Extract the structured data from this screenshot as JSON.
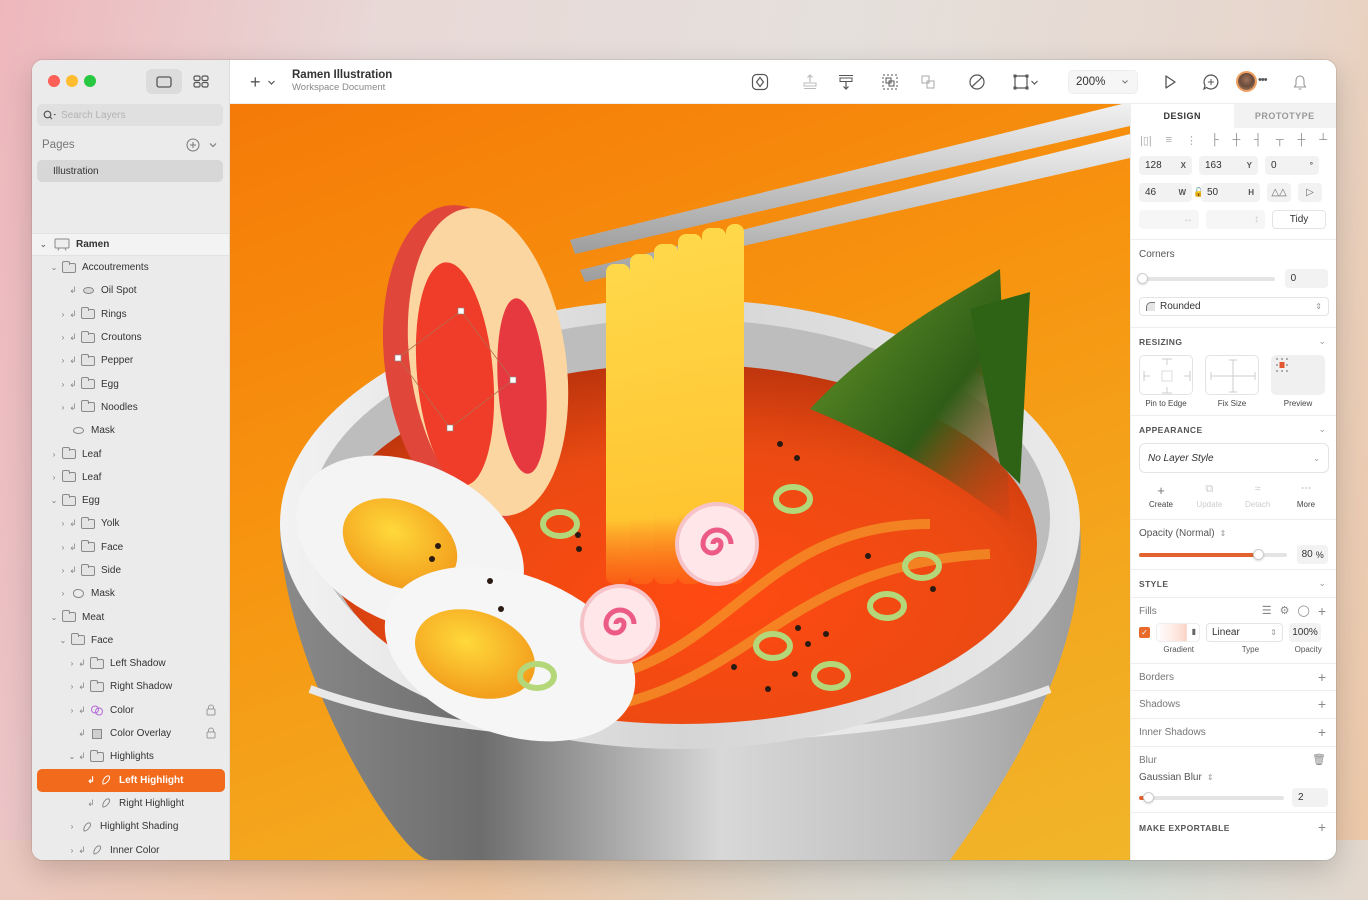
{
  "window": {
    "traffic_lights": [
      "close",
      "minimize",
      "zoom"
    ]
  },
  "sidebar": {
    "search_placeholder": "Search Layers",
    "pages_label": "Pages",
    "pages": [
      {
        "label": "Illustration",
        "selected": true
      }
    ],
    "layers": [
      {
        "label": "Ramen",
        "type": "artboard",
        "depth": 0,
        "expanded": true
      },
      {
        "label": "Accoutrements",
        "type": "group",
        "depth": 1,
        "expanded": true
      },
      {
        "label": "Oil Spot",
        "type": "oval",
        "depth": 2,
        "masked": true
      },
      {
        "label": "Rings",
        "type": "group",
        "depth": 2,
        "masked": true,
        "collapsed": true
      },
      {
        "label": "Croutons",
        "type": "group",
        "depth": 2,
        "masked": true,
        "collapsed": true
      },
      {
        "label": "Pepper",
        "type": "group",
        "depth": 2,
        "masked": true,
        "collapsed": true
      },
      {
        "label": "Egg",
        "type": "group",
        "depth": 2,
        "masked": true,
        "collapsed": true
      },
      {
        "label": "Noodles",
        "type": "group",
        "depth": 2,
        "masked": true,
        "collapsed": true
      },
      {
        "label": "Mask",
        "type": "oval-outline",
        "depth": 2
      },
      {
        "label": "Leaf",
        "type": "group",
        "depth": 1,
        "collapsed": true
      },
      {
        "label": "Leaf",
        "type": "group",
        "depth": 1,
        "collapsed": true
      },
      {
        "label": "Egg",
        "type": "group",
        "depth": 1,
        "expanded": true
      },
      {
        "label": "Yolk",
        "type": "group",
        "depth": 2,
        "masked": true,
        "collapsed": true
      },
      {
        "label": "Face",
        "type": "group",
        "depth": 2,
        "masked": true,
        "collapsed": true
      },
      {
        "label": "Side",
        "type": "group",
        "depth": 2,
        "masked": true,
        "collapsed": true
      },
      {
        "label": "Mask",
        "type": "shape-outline",
        "depth": 2,
        "collapsed": true
      },
      {
        "label": "Meat",
        "type": "group",
        "depth": 1,
        "expanded": true
      },
      {
        "label": "Face",
        "type": "group",
        "depth": 2,
        "expanded": true
      },
      {
        "label": "Left Shadow",
        "type": "group",
        "depth": 3,
        "masked": true,
        "collapsed": true
      },
      {
        "label": "Right Shadow",
        "type": "group",
        "depth": 3,
        "masked": true,
        "collapsed": true
      },
      {
        "label": "Color",
        "type": "symbol",
        "depth": 3,
        "masked": true,
        "collapsed": true,
        "locked": true
      },
      {
        "label": "Color Overlay",
        "type": "rect",
        "depth": 3,
        "masked": true,
        "locked": true
      },
      {
        "label": "Highlights",
        "type": "group",
        "depth": 3,
        "masked": true,
        "expanded": true
      },
      {
        "label": "Left Highlight",
        "type": "path",
        "depth": 4,
        "masked": true,
        "selected": true
      },
      {
        "label": "Right Highlight",
        "type": "path",
        "depth": 4,
        "masked": true
      },
      {
        "label": "Highlight Shading",
        "type": "path",
        "depth": 3,
        "collapsed": true
      },
      {
        "label": "Inner Color",
        "type": "path",
        "depth": 3,
        "masked": true,
        "collapsed": true
      }
    ]
  },
  "toolbar": {
    "doc_title": "Ramen Illustration",
    "doc_subtitle": "Workspace Document",
    "zoom_level": "200%",
    "icons": [
      "insert-plus",
      "create-symbol",
      "forward",
      "backward",
      "mask",
      "ungroup",
      "edit-path",
      "transform",
      "zoom-dropdown",
      "play-prototype",
      "comments",
      "avatar",
      "notifications"
    ]
  },
  "inspector": {
    "tabs": [
      "DESIGN",
      "PROTOTYPE"
    ],
    "active_tab": "DESIGN",
    "x": "128",
    "x_unit": "X",
    "y": "163",
    "y_unit": "Y",
    "rotation": "0",
    "rotation_unit": "°",
    "w": "46",
    "w_unit": "W",
    "h": "50",
    "h_unit": "H",
    "tidy_label": "Tidy",
    "corners_label": "Corners",
    "corners_value": "0",
    "corner_style": "Rounded",
    "resizing_title": "RESIZING",
    "resizing_options": [
      "Pin to Edge",
      "Fix Size",
      "Preview"
    ],
    "appearance_title": "APPEARANCE",
    "layer_style": "No Layer Style",
    "style_actions": [
      {
        "label": "Create",
        "enabled": true
      },
      {
        "label": "Update",
        "enabled": false
      },
      {
        "label": "Detach",
        "enabled": false
      },
      {
        "label": "More",
        "enabled": true
      }
    ],
    "opacity_label": "Opacity (Normal)",
    "opacity_value": "80",
    "opacity_unit": "%",
    "opacity_fraction": 0.8,
    "style_title": "STYLE",
    "fills_label": "Fills",
    "fill": {
      "enabled": true,
      "type": "Linear",
      "opacity": "100%",
      "caption_gradient": "Gradient",
      "caption_type": "Type",
      "caption_opacity": "Opacity"
    },
    "borders_label": "Borders",
    "shadows_label": "Shadows",
    "inner_shadows_label": "Inner Shadows",
    "blur_label": "Blur",
    "blur_type": "Gaussian Blur",
    "blur_value": "2",
    "blur_fraction": 0.02,
    "export_title": "MAKE EXPORTABLE"
  },
  "colors": {
    "accent": "#f26b1d",
    "canvas_bg": "#f7930f",
    "selected_layer": "#f26b1d"
  }
}
